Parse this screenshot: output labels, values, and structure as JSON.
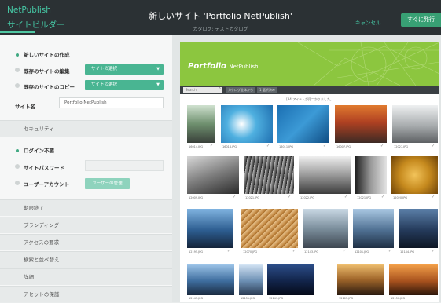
{
  "header": {
    "brand_line1": "NetPublish",
    "brand_line2": "サイトビルダー",
    "title": "新しいサイト 'Portfolio NetPublish'",
    "subtitle": "カタログ: テストカタログ",
    "cancel_label": "キャンセル",
    "publish_label": "すぐに発行"
  },
  "left": {
    "options": [
      {
        "label": "新しいサイトの作成",
        "selected": true
      },
      {
        "label": "既存のサイトの編集",
        "selected": false,
        "select": "サイトの選択"
      },
      {
        "label": "既存のサイトのコピー",
        "selected": false,
        "select": "サイトの選択"
      }
    ],
    "site_name_label": "サイト名",
    "site_name_value": "Portfolio NetPublish",
    "security_title": "セキュリティ",
    "login_options": [
      {
        "label": "ログイン不要",
        "selected": true
      },
      {
        "label": "サイトパスワード",
        "selected": false
      },
      {
        "label": "ユーザーアカウント",
        "selected": false
      }
    ],
    "user_select_button": "ユーザーの管理",
    "sections": [
      "期限終了",
      "ブランディング",
      "アクセスの要求",
      "検索と並べ替え",
      "詳細",
      "アセットの保護"
    ]
  },
  "preview": {
    "logo_main": "Portfolio",
    "logo_sub": "NetPublish",
    "search_placeholder": "Search",
    "toolbar_buttons": [
      "カタログ全体から",
      "1 選択済み"
    ],
    "count_text": "[84]アイテムが見つかりました。",
    "thumbs": [
      {
        "caption": "16014.JPG"
      },
      {
        "caption": "16016.JPG"
      },
      {
        "caption": "16011.JPG"
      },
      {
        "caption": "16007.JPG"
      },
      {
        "caption": "12027.JPG"
      },
      {
        "caption": "12009.JPG"
      },
      {
        "caption": "12021.JPG"
      },
      {
        "caption": "12022.JPG"
      },
      {
        "caption": "12021.JPG"
      },
      {
        "caption": "12020.JPG"
      },
      {
        "caption": "12195.JPG"
      },
      {
        "caption": "12070.JPG"
      },
      {
        "caption": "12143.JPG"
      },
      {
        "caption": "12101.JPG"
      },
      {
        "caption": "12144.JPG"
      },
      {
        "caption": "12145.JPG"
      },
      {
        "caption": "12151.JPG"
      },
      {
        "caption": "12149.JPG"
      },
      {
        "caption": "12105.JPG"
      },
      {
        "caption": "12150.JPG"
      }
    ]
  }
}
